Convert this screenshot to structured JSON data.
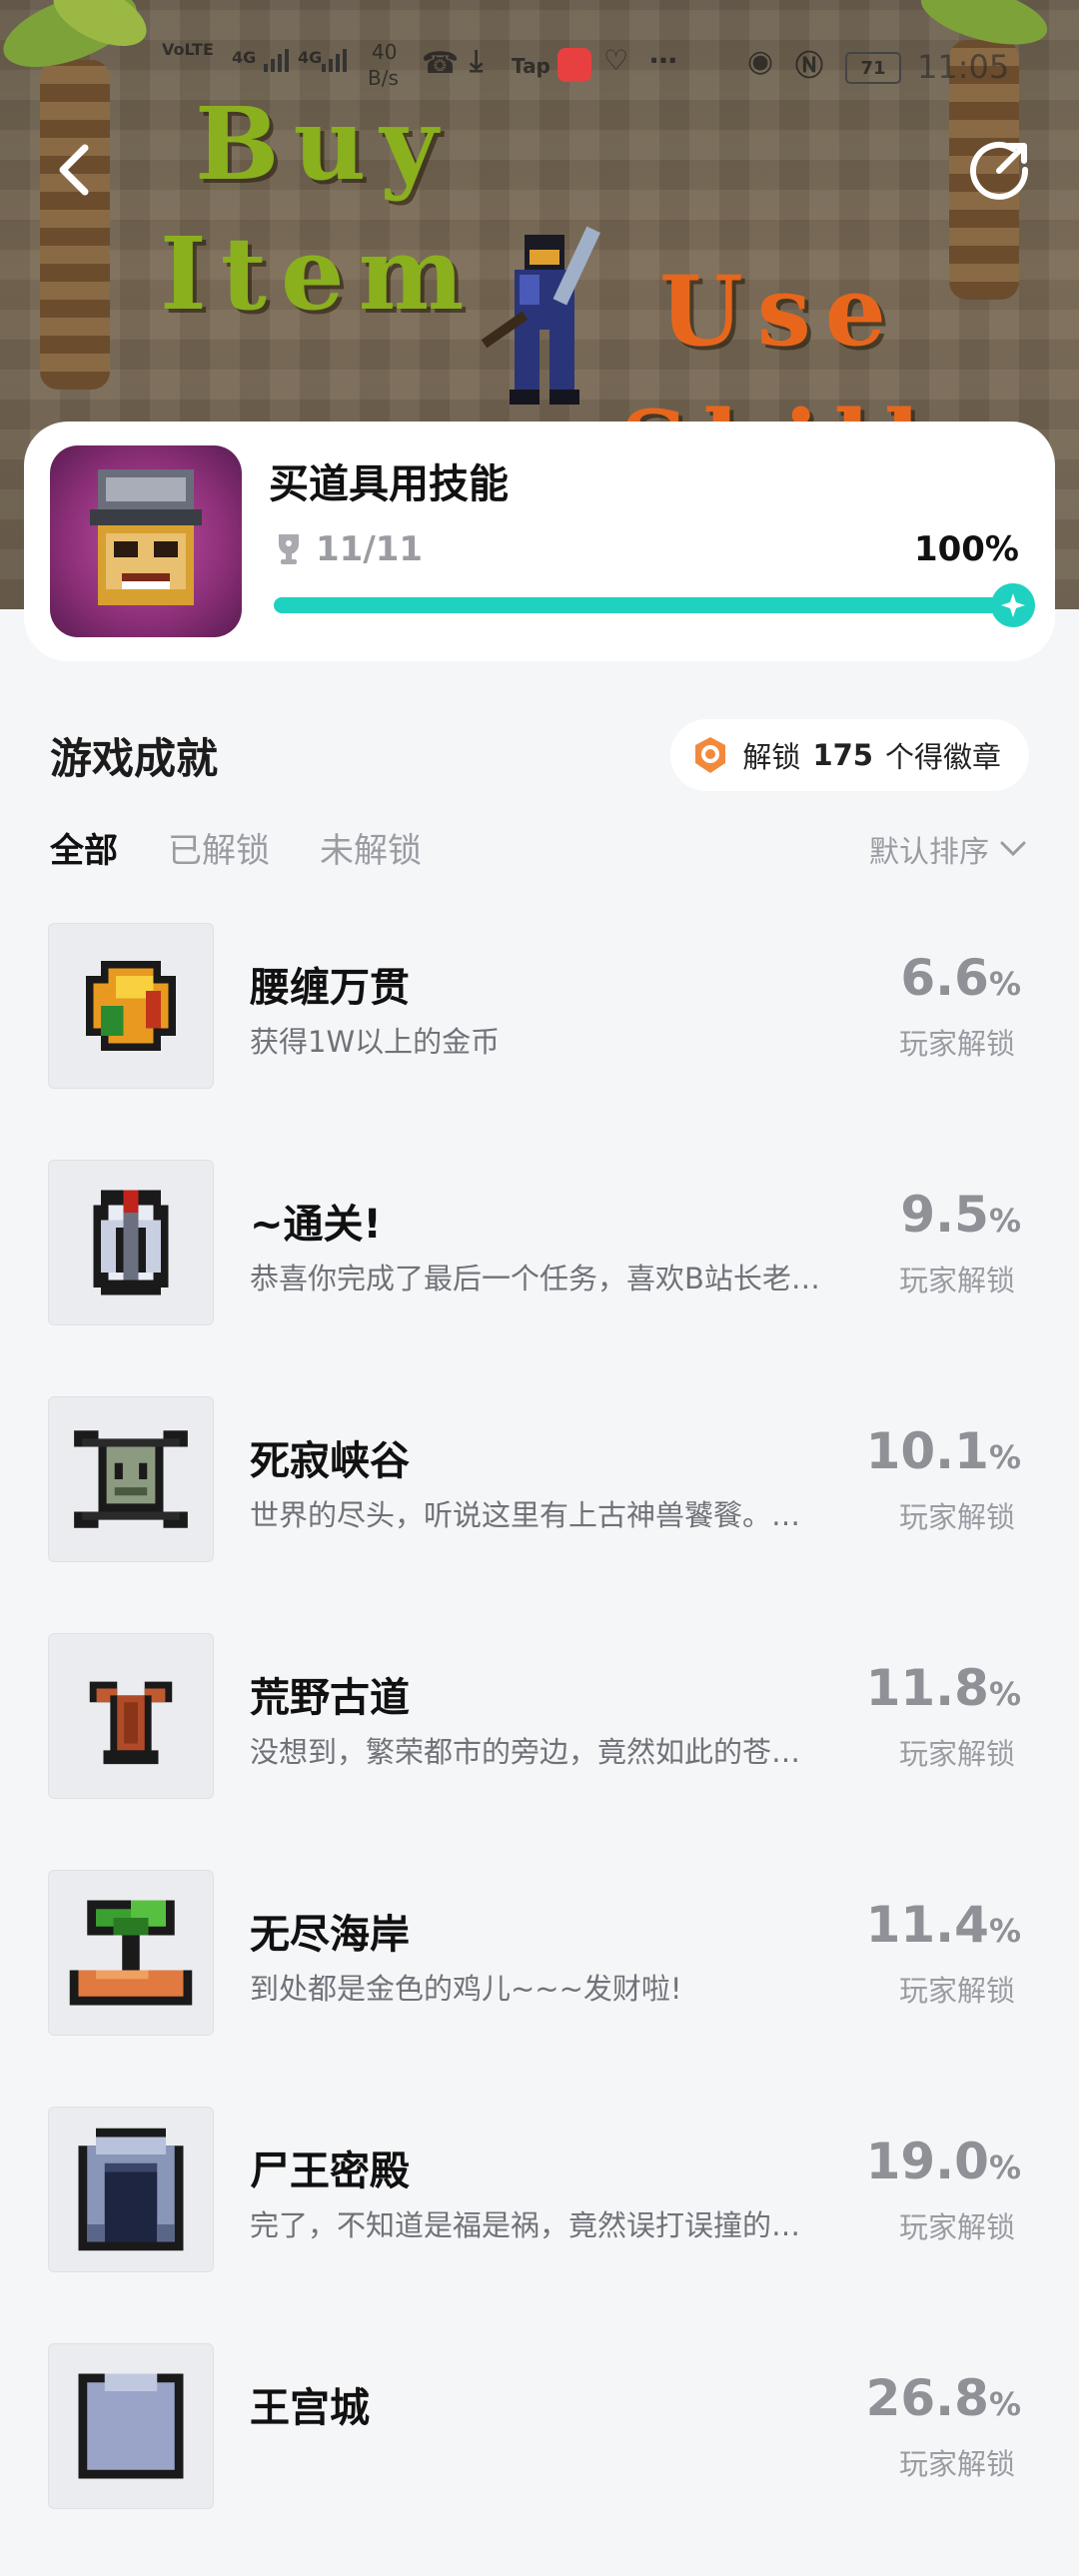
{
  "status_bar": {
    "carrier_left": "VoLTE",
    "net1": "4G",
    "net2": "4G",
    "speed": "40",
    "speed_unit": "B/s",
    "tap_label": "Tap",
    "battery": "71",
    "time": "11:05"
  },
  "hero": {
    "words": [
      "Buy",
      "Item",
      "Use",
      "Skill"
    ]
  },
  "game": {
    "title": "买道具用技能",
    "trophies": "11/11",
    "percent_text": "100%",
    "progress": 1.0
  },
  "achievements_section": {
    "title": "游戏成就",
    "badge_prefix": "解锁",
    "badge_count": "175",
    "badge_suffix": "个得徽章",
    "filters": [
      "全部",
      "已解锁",
      "未解锁"
    ],
    "sort_label": "默认排序"
  },
  "achievements": [
    {
      "name": "腰缠万贯",
      "desc": "获得1W以上的金币",
      "pct": "6.6",
      "unit": "%",
      "label": "玩家解锁",
      "icon": "gold-coin-icon"
    },
    {
      "name": "~通关!",
      "desc": "恭喜你完成了最后一个任务，喜欢B站长老…",
      "pct": "9.5",
      "unit": "%",
      "label": "玩家解锁",
      "icon": "knight-helmet-icon"
    },
    {
      "name": "死寂峡谷",
      "desc": "世界的尽头，听说这里有上古神兽饕餮。…",
      "pct": "10.1",
      "unit": "%",
      "label": "玩家解锁",
      "icon": "skull-crossbones-icon"
    },
    {
      "name": "荒野古道",
      "desc": "没想到，繁荣都市的旁边，竟然如此的苍…",
      "pct": "11.8",
      "unit": "%",
      "label": "玩家解锁",
      "icon": "dead-tree-icon"
    },
    {
      "name": "无尽海岸",
      "desc": "到处都是金色的鸡儿~~~发财啦!",
      "pct": "11.4",
      "unit": "%",
      "label": "玩家解锁",
      "icon": "palm-island-icon"
    },
    {
      "name": "尸王密殿",
      "desc": "完了，不知道是福是祸，竟然误打误撞的…",
      "pct": "19.0",
      "unit": "%",
      "label": "玩家解锁",
      "icon": "stone-archway-icon"
    },
    {
      "name": "王宫城",
      "desc": "",
      "pct": "26.8",
      "unit": "%",
      "label": "玩家解锁",
      "icon": "castle-icon"
    }
  ],
  "colors": {
    "accent": "#1fd1c0",
    "buy_word": "#8ab01e",
    "use_word": "#e8661c",
    "badge_orange": "#f28a3c"
  }
}
